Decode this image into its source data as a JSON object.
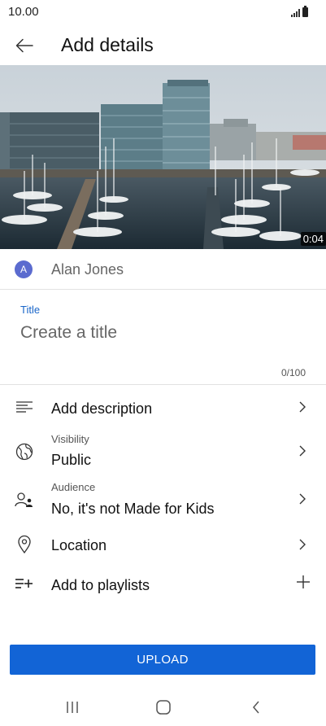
{
  "status_bar": {
    "time": "10.00"
  },
  "header": {
    "title": "Add details"
  },
  "video": {
    "duration": "0:04"
  },
  "channel": {
    "avatar_letter": "A",
    "name": "Alan Jones",
    "avatar_color": "#5b6bcf"
  },
  "title_field": {
    "label": "Title",
    "placeholder": "Create a title",
    "value": "",
    "counter": "0/100"
  },
  "options": [
    {
      "label": "Add description",
      "icon": "description-icon",
      "action": "chevron"
    },
    {
      "sublabel": "Visibility",
      "label": "Public",
      "icon": "globe-icon",
      "action": "chevron"
    },
    {
      "sublabel": "Audience",
      "label": "No, it's not Made for Kids",
      "icon": "audience-icon",
      "action": "chevron"
    },
    {
      "label": "Location",
      "icon": "location-pin-icon",
      "action": "chevron"
    },
    {
      "label": "Add to playlists",
      "icon": "playlist-add-icon",
      "action": "plus"
    }
  ],
  "upload": {
    "label": "UPLOAD"
  },
  "colors": {
    "accent": "#1264d6",
    "label_blue": "#1a66c9"
  }
}
